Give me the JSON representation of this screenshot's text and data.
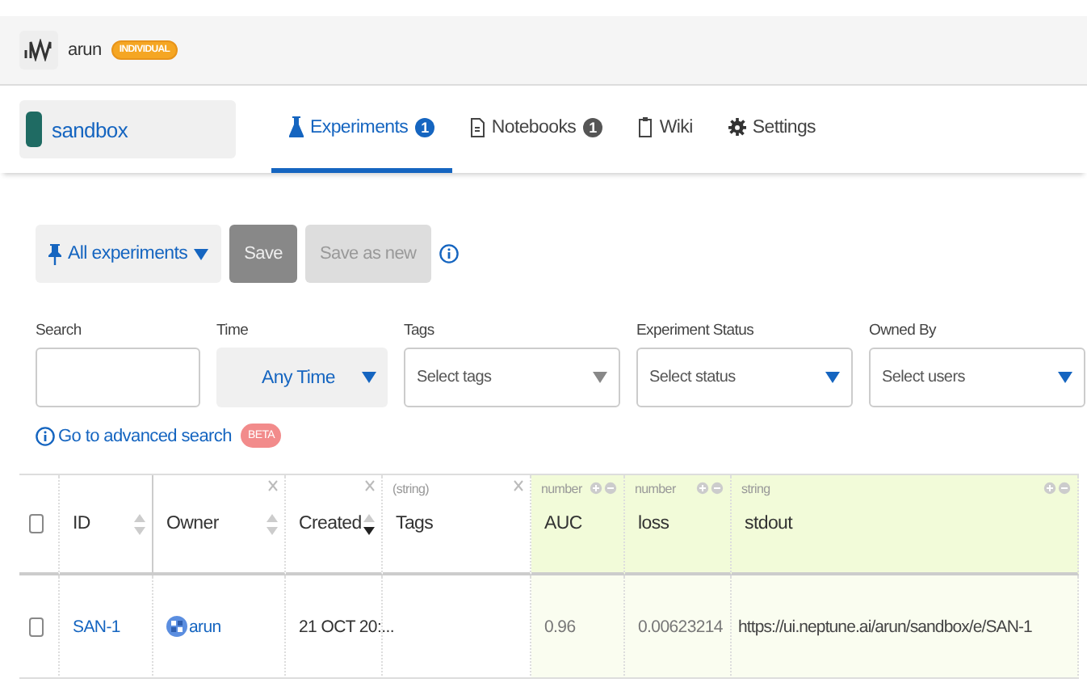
{
  "header": {
    "user": "arun",
    "badge": "INDIVIDUAL"
  },
  "project": {
    "name": "sandbox",
    "color": "#1f6b63"
  },
  "tabs": [
    {
      "label": "Experiments",
      "count": "1",
      "selected": true
    },
    {
      "label": "Notebooks",
      "count": "1",
      "selected": false
    },
    {
      "label": "Wiki",
      "selected": false
    },
    {
      "label": "Settings",
      "selected": false
    }
  ],
  "toolbar": {
    "view": "All experiments",
    "buttons": [
      {
        "label": "Save",
        "disabled": false
      },
      {
        "label": "Save as new",
        "disabled": true
      }
    ]
  },
  "filters": [
    {
      "kind": "text",
      "label": "Search"
    },
    {
      "kind": "select",
      "label": "Time",
      "value": "Any Time"
    },
    {
      "kind": "select",
      "label": "Tags",
      "placeholder": "Select tags",
      "disabled": true
    },
    {
      "kind": "select",
      "label": "Experiment Status",
      "placeholder": "Select status",
      "disabled": false
    },
    {
      "kind": "select",
      "label": "Owned By",
      "placeholder": "Select users",
      "disabled": false
    }
  ],
  "advanced_search": {
    "label": "Go to advanced search",
    "badge": "BETA"
  },
  "table": {
    "columns": [
      {
        "kind": "checkbox",
        "checked": false
      },
      {
        "kind": "attr",
        "label": "ID",
        "sortable": true,
        "sorted": false,
        "removable": false
      },
      {
        "kind": "attr",
        "label": "Owner",
        "sortable": true,
        "sorted": false,
        "removable": true
      },
      {
        "kind": "attr",
        "label": "Created",
        "sortable": true,
        "sorted": true,
        "removable": true
      },
      {
        "kind": "attr",
        "label": "Tags",
        "type": "(string)",
        "removable": true
      },
      {
        "kind": "metric",
        "label": "AUC",
        "type": "number"
      },
      {
        "kind": "metric",
        "label": "loss",
        "type": "number"
      },
      {
        "kind": "metric",
        "label": "stdout",
        "type": "string"
      }
    ],
    "rows": [
      {
        "checked": false,
        "id": "SAN-1",
        "owner": "arun",
        "created": "21 OCT 20:...",
        "auc": "0.96",
        "loss": "0.00623214",
        "stdout": "https://ui.neptune.ai/arun/sandbox/e/SAN-1"
      }
    ]
  }
}
